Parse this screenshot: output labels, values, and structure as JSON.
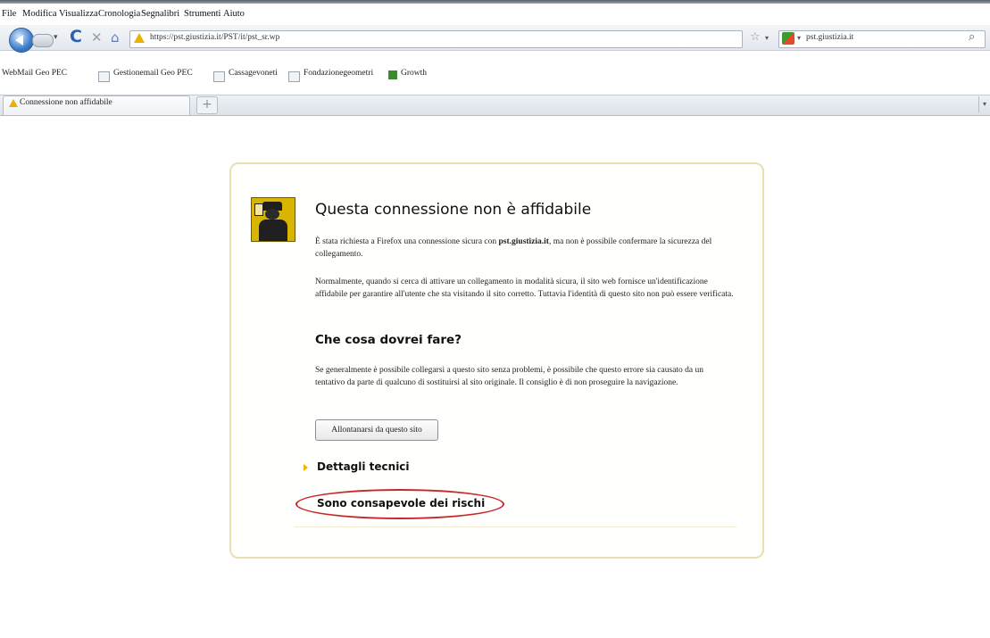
{
  "menubar": {
    "items": [
      "File",
      "Modifica",
      "Visualizza",
      "Cronologia",
      "Segnalibri",
      "Strumenti",
      "Aiuto"
    ]
  },
  "navbar": {
    "url": "https://pst.giustizia.it/PST/it/pst_sr.wp",
    "search_text": "pst.giustizia.it",
    "icons": [
      "back-icon",
      "forward-icon",
      "reload-icon",
      "stop-icon",
      "home-icon",
      "star-icon",
      "search-icon"
    ]
  },
  "bookmarks": {
    "items": [
      "WebMail Geo PEC",
      "Gestionemail Geo PEC",
      "Cassagevoneti",
      "Fondazionegeometri",
      "Growth"
    ]
  },
  "tabs": {
    "active_title": "Connessione non affidabile",
    "new_tab_label": "+"
  },
  "error_page": {
    "title": "Questa connessione non è affidabile",
    "para1_pre": "È stata richiesta a Firefox una connessione sicura con ",
    "para1_host": "pst.giustizia.it",
    "para1_post": ", ma non è possibile confermare la sicurezza del collegamento.",
    "para2": "Normalmente, quando si cerca di attivare un collegamento in modalità sicura, il sito web fornisce un'identificazione affidabile per garantire all'utente che sta visitando il sito corretto. Tuttavia l'identità di questo sito non può essere verificata.",
    "subtitle": "Che cosa dovrei fare?",
    "para3": "Se generalmente è possibile collegarsi a questo sito senza problemi, è possibile che questo errore sia causato da un tentativo da parte di qualcuno di sostituirsi al sito originale. Il consiglio è di non proseguire la navigazione.",
    "leave_button": "Allontanarsi da questo sito",
    "details_label": "Dettagli tecnici",
    "risks_label": "Sono consapevole dei rischi"
  },
  "colors": {
    "box_border": "#eadfae",
    "warning_yellow": "#e9b100",
    "highlight_ellipse": "#c8282d"
  }
}
